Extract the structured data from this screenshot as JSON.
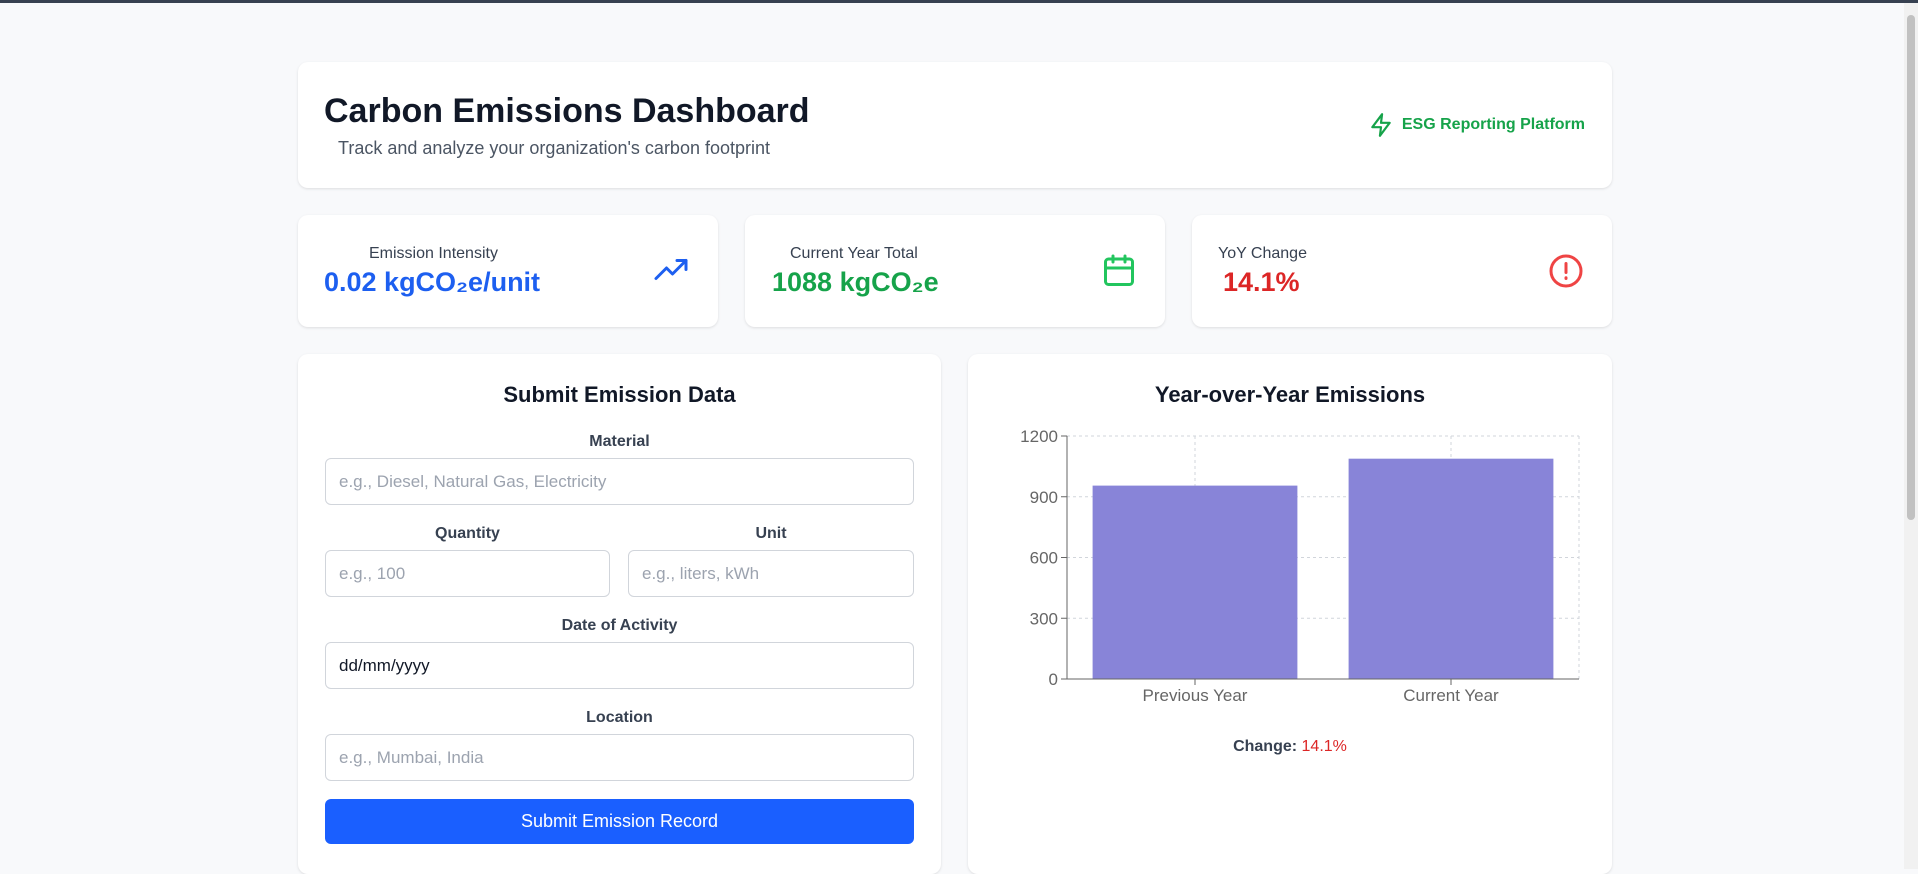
{
  "header": {
    "title": "Carbon Emissions Dashboard",
    "subtitle": "Track and analyze your organization's carbon footprint",
    "brand_label": "ESG Reporting Platform",
    "brand_icon": "lightning-icon"
  },
  "stats": [
    {
      "label": "Emission Intensity",
      "value": "0.02 kgCO₂e/unit",
      "icon": "trending-up-icon",
      "color": "#1d5ff0"
    },
    {
      "label": "Current Year Total",
      "value": "1088 kgCO₂e",
      "icon": "calendar-icon",
      "color": "#16a34a"
    },
    {
      "label": "YoY Change",
      "value": "14.1%",
      "icon": "alert-circle-icon",
      "color": "#dc2626"
    }
  ],
  "form": {
    "title": "Submit Emission Data",
    "material": {
      "label": "Material",
      "placeholder": "e.g., Diesel, Natural Gas, Electricity",
      "value": ""
    },
    "quantity": {
      "label": "Quantity",
      "placeholder": "e.g., 100",
      "value": ""
    },
    "unit": {
      "label": "Unit",
      "placeholder": "e.g., liters, kWh",
      "value": ""
    },
    "date": {
      "label": "Date of Activity",
      "value": "dd/mm/yyyy"
    },
    "location": {
      "label": "Location",
      "placeholder": "e.g., Mumbai, India",
      "value": ""
    },
    "submit_label": "Submit Emission Record"
  },
  "chart_panel": {
    "title": "Year-over-Year Emissions",
    "change_label": "Change:",
    "change_value": "14.1%"
  },
  "chart_data": {
    "type": "bar",
    "categories": [
      "Previous Year",
      "Current Year"
    ],
    "values": [
      955,
      1088
    ],
    "yticks": [
      0,
      300,
      600,
      900,
      1200
    ],
    "ylim": [
      0,
      1200
    ],
    "grid": true,
    "bar_color": "#8884d8",
    "title": "Year-over-Year Emissions"
  }
}
